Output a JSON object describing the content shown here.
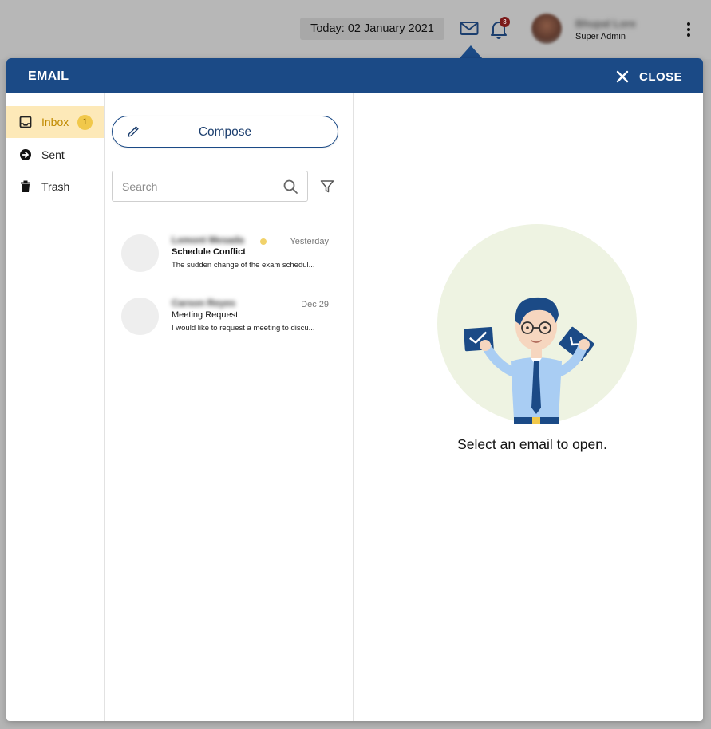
{
  "topbar": {
    "date_label": "Today: 02 January 2021",
    "notification_count": "3",
    "user_name": "Bhupal Lore",
    "user_role": "Super Admin"
  },
  "email": {
    "title": "EMAIL",
    "close_label": "CLOSE",
    "folders": [
      {
        "label": "Inbox",
        "badge": "1",
        "icon": "inbox-icon",
        "active": true
      },
      {
        "label": "Sent",
        "icon": "sent-arrow-icon"
      },
      {
        "label": "Trash",
        "icon": "trash-icon"
      }
    ],
    "compose_label": "Compose",
    "search_placeholder": "Search",
    "messages": [
      {
        "sender": "Lemont Mesada",
        "date": "Yesterday",
        "subject": "Schedule Conflict",
        "preview": "The sudden change of the exam schedul...",
        "unread": true
      },
      {
        "sender": "Carson Reyes",
        "date": "Dec 29",
        "subject": "Meeting Request",
        "preview": "I would like to request a meeting to discu...",
        "unread": false
      }
    ],
    "empty_message": "Select an email to open."
  },
  "colors": {
    "header": "#1b4a86",
    "active_folder_bg": "#fde9b8",
    "badge": "#f1c84a",
    "illustration_bg": "#eef3e2"
  }
}
